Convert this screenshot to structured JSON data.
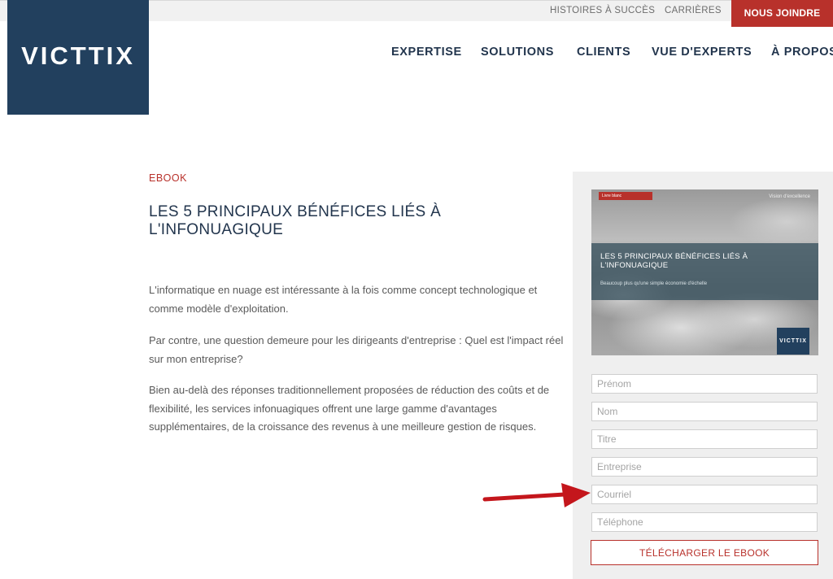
{
  "topbar": {
    "links": [
      "HISTOIRES À SUCCÈS",
      "CARRIÈRES"
    ],
    "join_label": "NOUS JOINDRE"
  },
  "brand": {
    "logo_text": "VICTTIX"
  },
  "nav": {
    "items": [
      "EXPERTISE",
      "SOLUTIONS",
      "CLIENTS",
      "VUE D'EXPERTS",
      "À PROPOS"
    ]
  },
  "content": {
    "tag": "EBOOK",
    "title": "LES 5 PRINCIPAUX BÉNÉFICES LIÉS À L'INFONUAGIQUE",
    "paragraphs": [
      "L'informatique en nuage est intéressante à la fois comme concept technologique et comme modèle d'exploitation.",
      "Par contre, une question demeure pour les dirigeants d'entreprise : Quel est l'impact réel sur mon entreprise?",
      "Bien au-delà des réponses traditionnellement proposées de réduction des coûts et de flexibilité, les services infonuagiques offrent une large gamme d'avantages supplémentaires, de la croissance des revenus à une meilleure gestion de risques."
    ]
  },
  "cover": {
    "badge": "Livre blanc",
    "top_right": "Vision d'excellence",
    "title": "LES 5 PRINCIPAUX BÉNÉFICES LIÉS À L'INFONUAGIQUE",
    "subtitle": "Beaucoup plus qu'une simple économie d'échelle",
    "logo": "VICTTIX"
  },
  "form": {
    "fields": [
      {
        "placeholder": "Prénom"
      },
      {
        "placeholder": "Nom"
      },
      {
        "placeholder": "Titre"
      },
      {
        "placeholder": "Entreprise"
      },
      {
        "placeholder": "Courriel"
      },
      {
        "placeholder": "Téléphone"
      }
    ],
    "submit_label": "TÉLÉCHARGER LE EBOOK"
  },
  "colors": {
    "brand_navy": "#22405e",
    "accent_red": "#b8312b",
    "annotation_arrow": "#c4161c"
  },
  "annotation": {
    "icon": "arrow-right-icon",
    "points_to": "Courriel"
  }
}
